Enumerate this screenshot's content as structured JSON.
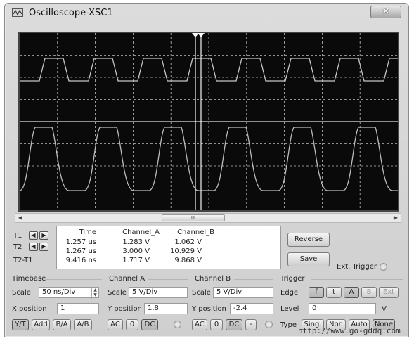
{
  "window": {
    "title": "Oscilloscope-XSC1",
    "close_label": "✕"
  },
  "scrollbar": {
    "thumb_label": "III"
  },
  "cursors": {
    "labels": [
      "T1",
      "T2",
      "T2-T1"
    ],
    "headers": [
      "Time",
      "Channel_A",
      "Channel_B"
    ],
    "rows": [
      [
        "1.257 us",
        "1.283 V",
        "1.062 V"
      ],
      [
        "1.267 us",
        "3.000 V",
        "10.929 V"
      ],
      [
        "9.416 ns",
        "1.717 V",
        "9.868 V"
      ]
    ]
  },
  "buttons": {
    "reverse": "Reverse",
    "save": "Save",
    "ext_trigger": "Ext. Trigger"
  },
  "timebase": {
    "title": "Timebase",
    "scale_label": "Scale",
    "scale_value": "50 ns/Div",
    "xpos_label": "X position",
    "xpos_value": "1",
    "modes": [
      "Y/T",
      "Add",
      "B/A",
      "A/B"
    ]
  },
  "channel_a": {
    "title": "Channel A",
    "scale_label": "Scale",
    "scale_value": "5 V/Div",
    "ypos_label": "Y position",
    "ypos_value": "1.8",
    "coupling": [
      "AC",
      "0",
      "DC"
    ]
  },
  "channel_b": {
    "title": "Channel B",
    "scale_label": "Scale",
    "scale_value": "5 V/Div",
    "ypos_label": "Y position",
    "ypos_value": "-2.4",
    "coupling": [
      "AC",
      "0",
      "DC",
      "-"
    ]
  },
  "trigger": {
    "title": "Trigger",
    "edge_label": "Edge",
    "edges": [
      "f",
      "t",
      "A",
      "B",
      "Ext"
    ],
    "level_label": "Level",
    "level_value": "0",
    "level_unit": "V",
    "type_label": "Type",
    "types": [
      "Sing.",
      "Nor.",
      "Auto",
      "None"
    ]
  },
  "watermark": "http://www.go-gddq.com",
  "colors": {
    "screen": "#0a0a0a",
    "trace": "#cfcfcf",
    "grid": "#bdbdbd",
    "window": "#d4d4d4"
  }
}
